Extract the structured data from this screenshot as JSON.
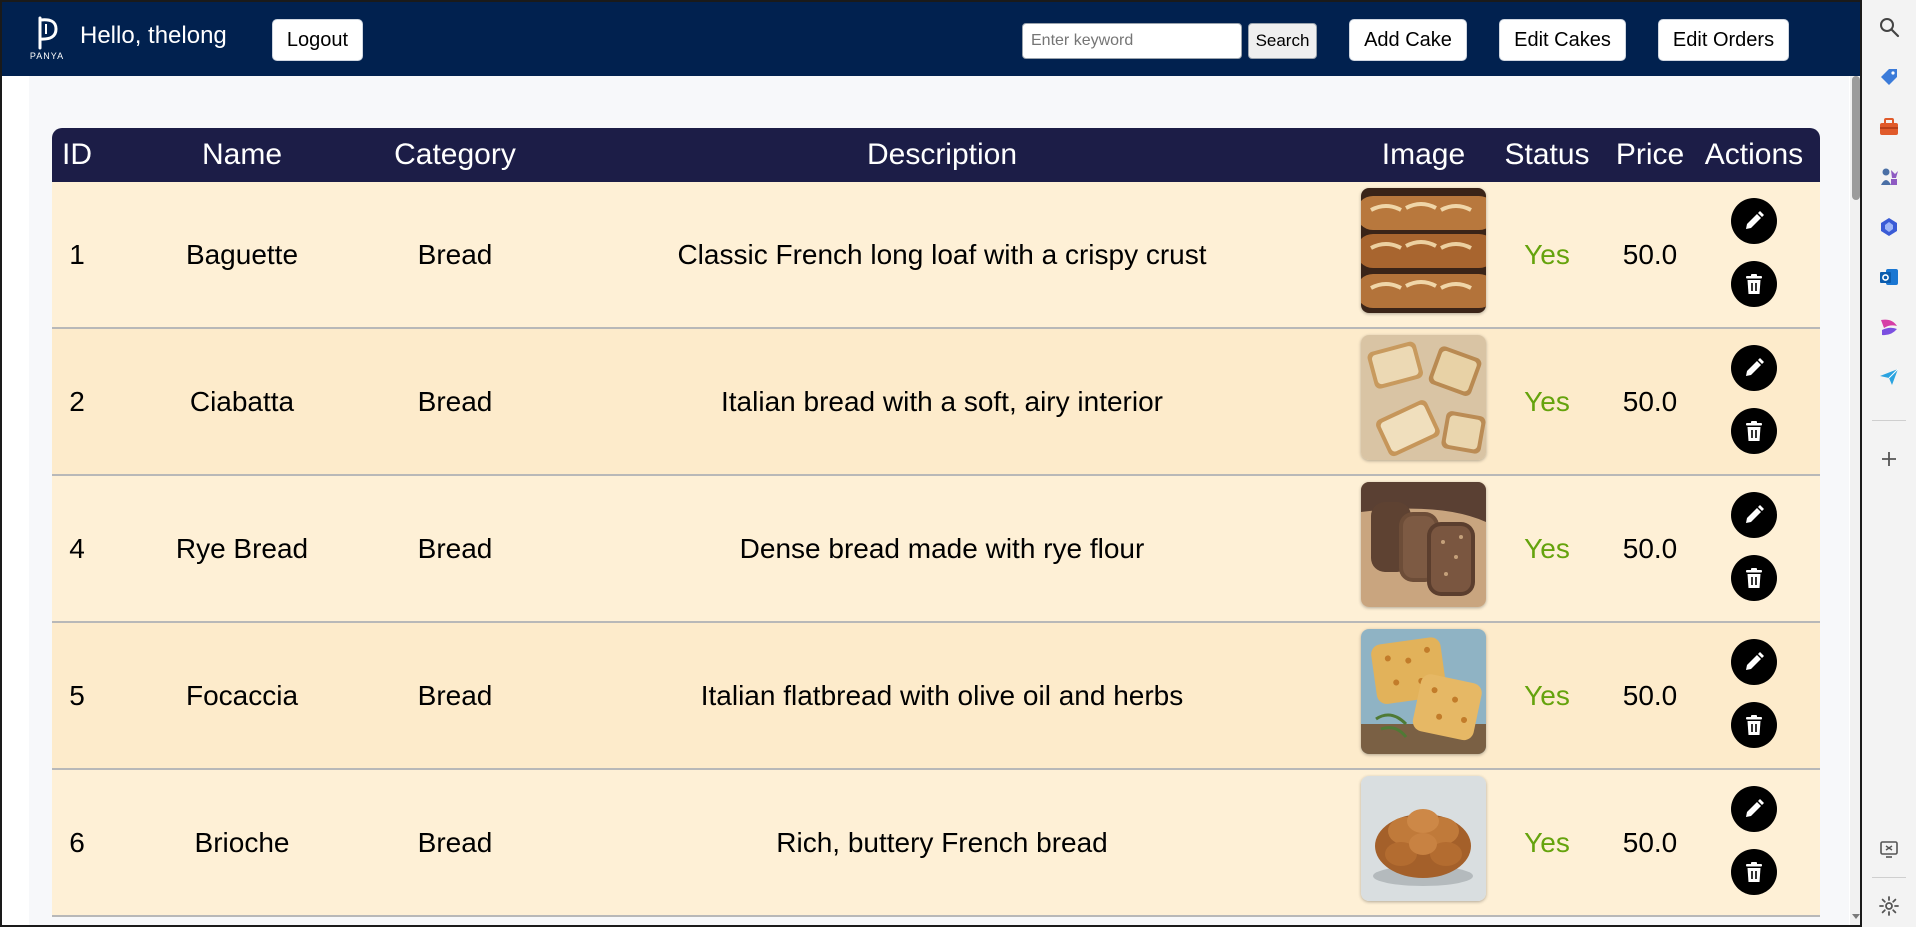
{
  "header": {
    "logo_text": "PANYA",
    "greeting": "Hello, thelong",
    "logout_label": "Logout",
    "search_placeholder": "Enter keyword",
    "search_value": "",
    "search_label": "Search",
    "add_cake_label": "Add Cake",
    "edit_cakes_label": "Edit Cakes",
    "edit_orders_label": "Edit Orders"
  },
  "table": {
    "columns": [
      "ID",
      "Name",
      "Category",
      "Description",
      "Image",
      "Status",
      "Price",
      "Actions"
    ],
    "rows": [
      {
        "id": "1",
        "name": "Baguette",
        "category": "Bread",
        "description": "Classic French long loaf with a crispy crust",
        "image": "baguette-photo",
        "status": "Yes",
        "price": "50.0"
      },
      {
        "id": "2",
        "name": "Ciabatta",
        "category": "Bread",
        "description": "Italian bread with a soft, airy interior",
        "image": "ciabatta-photo",
        "status": "Yes",
        "price": "50.0"
      },
      {
        "id": "4",
        "name": "Rye Bread",
        "category": "Bread",
        "description": "Dense bread made with rye flour",
        "image": "rye-bread-photo",
        "status": "Yes",
        "price": "50.0"
      },
      {
        "id": "5",
        "name": "Focaccia",
        "category": "Bread",
        "description": "Italian flatbread with olive oil and herbs",
        "image": "focaccia-photo",
        "status": "Yes",
        "price": "50.0"
      },
      {
        "id": "6",
        "name": "Brioche",
        "category": "Bread",
        "description": "Rich, buttery French bread",
        "image": "brioche-photo",
        "status": "Yes",
        "price": "50.0"
      }
    ]
  },
  "colors": {
    "navbar": "#01214f",
    "table_header": "#1c1d47",
    "row_bg": "#fdebcb",
    "status_yes": "#65a30d"
  },
  "sidebar_icons": [
    "search-icon",
    "tag-icon",
    "briefcase-icon",
    "chess-icon",
    "copilot-icon",
    "outlook-icon",
    "designer-icon",
    "send-icon",
    "add-icon",
    "screenshot-icon",
    "settings-icon"
  ]
}
